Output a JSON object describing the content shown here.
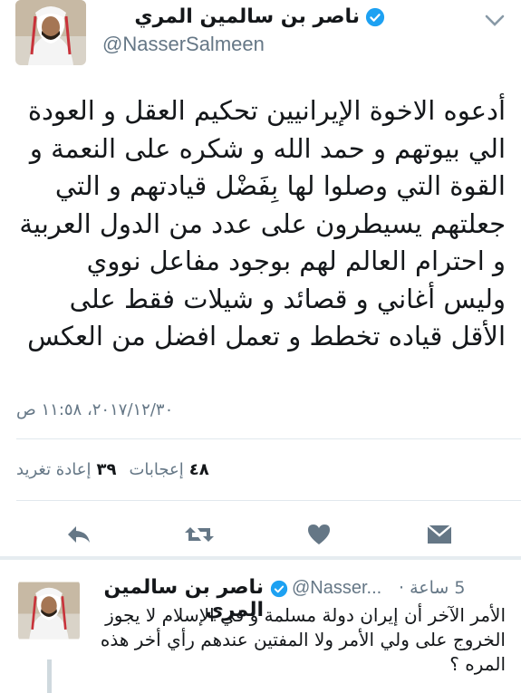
{
  "tweet": {
    "author_name": "ناصر بن سالمين المري",
    "handle": "@NasserSalmeen",
    "text": "أدعوه الاخوة الإيرانيين تحكيم العقل و العودة الي بيوتهم و حمد الله و شكره على النعمة و القوة التي وصلوا لها بِفَضْل قيادتهم و التي جعلتهم يسيطرون على عدد من الدول العربية و احترام العالم لهم بوجود مفاعل نووي وليس أغاني و قصائد و شيلات فقط على الأقل قياده تخطط و تعمل افضل من العكس",
    "timestamp": "٢٠١٧/١٢/٣٠، ١١:٥٨ ص",
    "likes_count": "٤٨",
    "likes_label": "إعجابات",
    "retweets_count": "٣٩",
    "retweets_label": "إعادة تغريد"
  },
  "actions": {
    "reply_icon": "reply-icon",
    "retweet_icon": "retweet-icon",
    "like_icon": "heart-icon",
    "dm_icon": "envelope-icon"
  },
  "reply": {
    "author_name": "ناصر بن سالمين المري",
    "handle": "@Nasser...",
    "time": "5 ساعة ·",
    "text": "الأمر الآخر أن إيران دولة مسلمة و في الإسلام لا يجوز الخروج على ولي الأمر ولا المفتين عندهم رأي أخر هذه المره ؟"
  },
  "colors": {
    "verified": "#1da1f2",
    "secondary_text": "#657786",
    "icon": "#657786"
  }
}
